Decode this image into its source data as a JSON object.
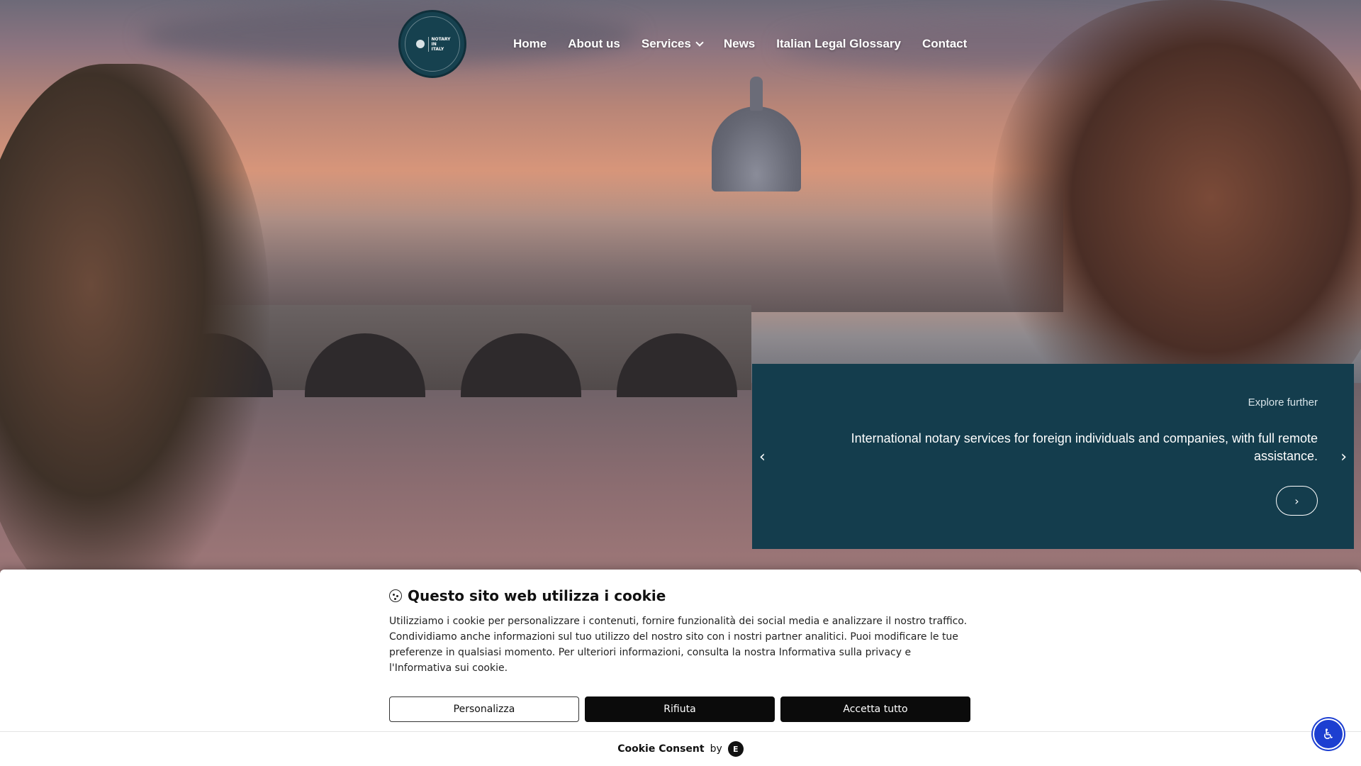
{
  "logo": {
    "line1": "NOTARY",
    "line2": "IN",
    "line3": "ITALY"
  },
  "nav": {
    "items": [
      {
        "label": "Home"
      },
      {
        "label": "About us"
      },
      {
        "label": "Services"
      },
      {
        "label": "News"
      },
      {
        "label": "Italian Legal Glossary"
      },
      {
        "label": "Contact"
      }
    ]
  },
  "slide": {
    "eyebrow": "Explore further",
    "text": "International notary services for foreign individuals and companies, with full remote assistance.",
    "button_glyph": "›",
    "prev_glyph": "‹",
    "next_glyph": "›"
  },
  "cookie": {
    "title": "Questo sito web utilizza i cookie",
    "text": "Utilizziamo i cookie per personalizzare i contenuti, fornire funzionalità dei social media e analizzare il nostro traffico. Condividiamo anche informazioni sul tuo utilizzo del nostro sito con i nostri partner analitici. Puoi modificare le tue preferenze in qualsiasi momento. Per ulteriori informazioni, consulta la nostra Informativa sulla privacy e l'Informativa sui cookie.",
    "buttons": {
      "customize": "Personalizza",
      "reject": "Rifiuta",
      "accept": "Accetta tutto"
    },
    "footer_brand": "Cookie Consent",
    "footer_by": "by",
    "footer_logo": "E"
  },
  "accessibility": {
    "glyph": "♿"
  },
  "colors": {
    "panel": "#143d4d",
    "logo": "#16414f",
    "accessibility": "#1d3fd1"
  }
}
